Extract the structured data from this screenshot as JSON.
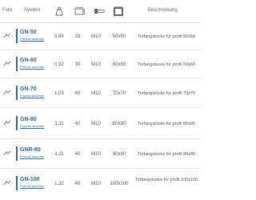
{
  "header": {
    "foto": "Foto",
    "symbol": "Symbol",
    "beschreibung": "Beschreibung",
    "icons": [
      "weight-icon",
      "length-icon",
      "bolt-icon",
      "profile-size-icon"
    ]
  },
  "colors": {
    "accent": "#2c6aa0",
    "border": "#e2e2e2",
    "text": "#555555"
  },
  "rows": [
    {
      "code": "GN-50",
      "link": "Produkt ansehen",
      "weight": "0,84",
      "length": "28",
      "bolt": "M10",
      "profile": "50x50",
      "description": "Torfangstücke für profil 50x50"
    },
    {
      "code": "GN-60",
      "link": "Produkt ansehen",
      "weight": "0,92",
      "length": "30",
      "bolt": "M10",
      "profile": "60x60",
      "description": "Torfangstücke für profil 60x60"
    },
    {
      "code": "GN-70",
      "link": "Produkt ansehen",
      "weight": "1,03",
      "length": "40",
      "bolt": "M10",
      "profile": "70x70",
      "description": "Torfangstücke für profil 70x70"
    },
    {
      "code": "GN-80",
      "link": "Produkt ansehen",
      "weight": "1,11",
      "length": "40",
      "bolt": "M10",
      "profile": "80X80",
      "description": "Torfangstücke für profil 80x80"
    },
    {
      "code": "GNR-80",
      "link": "Produkt ansehen",
      "weight": "1,11",
      "length": "40",
      "bolt": "M10",
      "profile": "80x80",
      "description": "Torfangstücke für profil 80x80"
    },
    {
      "code": "GN-100",
      "link": "Produkt ansehen",
      "weight": "1,32",
      "length": "40",
      "bolt": "M10",
      "profile": "100x100",
      "description": "Torfangstücke für profil 100x100"
    }
  ]
}
